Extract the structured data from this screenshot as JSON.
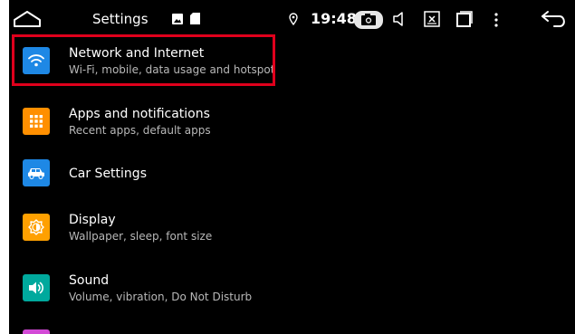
{
  "statusbar": {
    "title": "Settings",
    "time": "19:48",
    "icons": [
      "home-icon",
      "photo-icon",
      "sd-card-icon",
      "location-icon",
      "camera-icon",
      "volume-icon",
      "screenshot-icon",
      "recent-apps-icon",
      "more-icon",
      "back-icon"
    ]
  },
  "settings": {
    "items": [
      {
        "title": "Network and Internet",
        "subtitle": "Wi-Fi, mobile, data usage and hotspot",
        "icon": "wifi-icon",
        "color": "#1e88e5"
      },
      {
        "title": "Apps and notifications",
        "subtitle": "Recent apps, default apps",
        "icon": "apps-grid-icon",
        "color": "#ff8f00"
      },
      {
        "title": "Car Settings",
        "subtitle": "",
        "icon": "car-icon",
        "color": "#1e88e5"
      },
      {
        "title": "Display",
        "subtitle": "Wallpaper, sleep, font size",
        "icon": "brightness-icon",
        "color": "#ffa000"
      },
      {
        "title": "Sound",
        "subtitle": "Volume, vibration, Do Not Disturb",
        "icon": "speaker-icon",
        "color": "#00a99d"
      }
    ]
  },
  "colors": {
    "background": "#000000",
    "highlight": "#e0001c",
    "text": "#ffffff",
    "subtext": "#b8b8b8"
  }
}
